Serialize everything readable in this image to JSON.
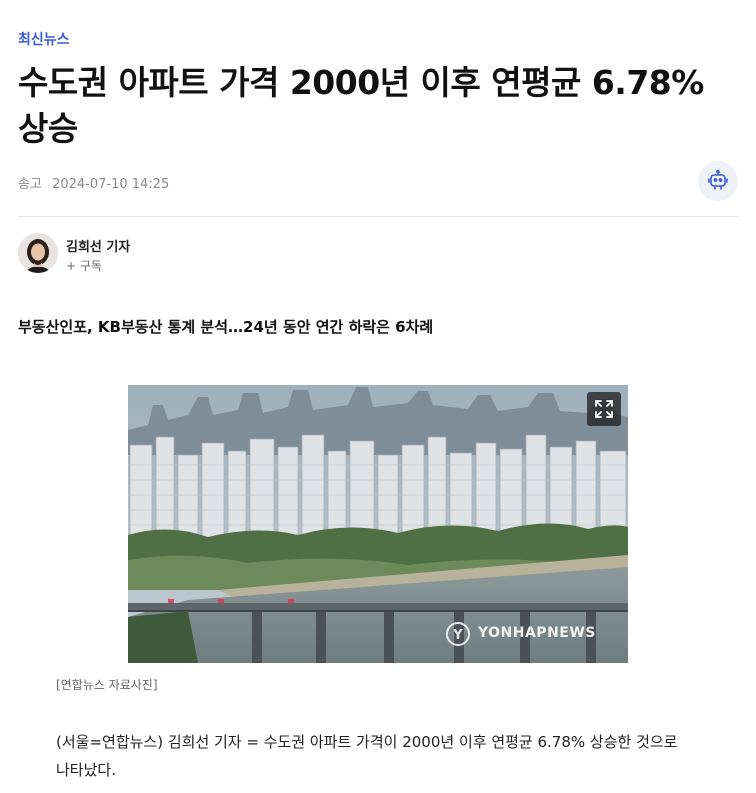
{
  "category": "최신뉴스",
  "headline": "수도권 아파트 가격 2000년 이후 연평균 6.78% 상승",
  "meta": {
    "label": "송고",
    "datetime": "2024-07-10 14:25"
  },
  "reporter": {
    "name": "김희선 기자",
    "subscribe": "+ 구독"
  },
  "subheadline": "부동산인포, KB부동산 통계 분석…24년 동안 연간 하락은 6차례",
  "photo": {
    "watermark": "YONHAPNEWS",
    "caption": "[연합뉴스 자료사진]"
  },
  "body": "(서울=연합뉴스) 김희선 기자 = 수도권 아파트 가격이 2000년 이후 연평균 6.78% 상승한 것으로 나타났다.",
  "icons": {
    "ai": "robot-icon",
    "expand": "expand-icon"
  },
  "colors": {
    "accent": "#3a5bd9",
    "meta": "#888888"
  }
}
